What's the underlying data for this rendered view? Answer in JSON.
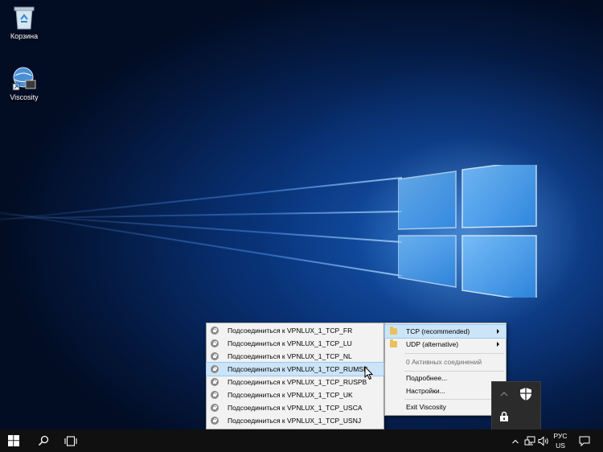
{
  "desktop": {
    "icons": [
      {
        "label": "Корзина",
        "icon": "recycle-bin-icon"
      },
      {
        "label": "Viscosity",
        "icon": "viscosity-icon"
      }
    ]
  },
  "context_menu": {
    "items": [
      {
        "label": "TCP (recommended)",
        "icon": "folder-icon",
        "submenu": true,
        "highlighted": true
      },
      {
        "label": "UDP (alternative)",
        "icon": "folder-icon",
        "submenu": true
      },
      {
        "label": "0 Активных соединений",
        "disabled": true
      },
      {
        "label": "Подробнее..."
      },
      {
        "label": "Настройки..."
      },
      {
        "label": "Exit Viscosity"
      }
    ]
  },
  "connections_submenu": {
    "items": [
      {
        "label": "Подсоединиться к VPNLUX_1_TCP_FR"
      },
      {
        "label": "Подсоединиться к VPNLUX_1_TCP_LU"
      },
      {
        "label": "Подсоединиться к VPNLUX_1_TCP_NL"
      },
      {
        "label": "Подсоединиться к VPNLUX_1_TCP_RUMSK",
        "highlighted": true
      },
      {
        "label": "Подсоединиться к VPNLUX_1_TCP_RUSPB"
      },
      {
        "label": "Подсоединиться к VPNLUX_1_TCP_UK"
      },
      {
        "label": "Подсоединиться к VPNLUX_1_TCP_USCA"
      },
      {
        "label": "Подсоединиться к VPNLUX_1_TCP_USNJ"
      }
    ]
  },
  "taskbar": {
    "language_top": "РУС",
    "language_bottom": "US"
  },
  "colors": {
    "highlight": "#cce4f7",
    "taskbar": "#101010",
    "menu_bg": "#f2f2f2"
  }
}
